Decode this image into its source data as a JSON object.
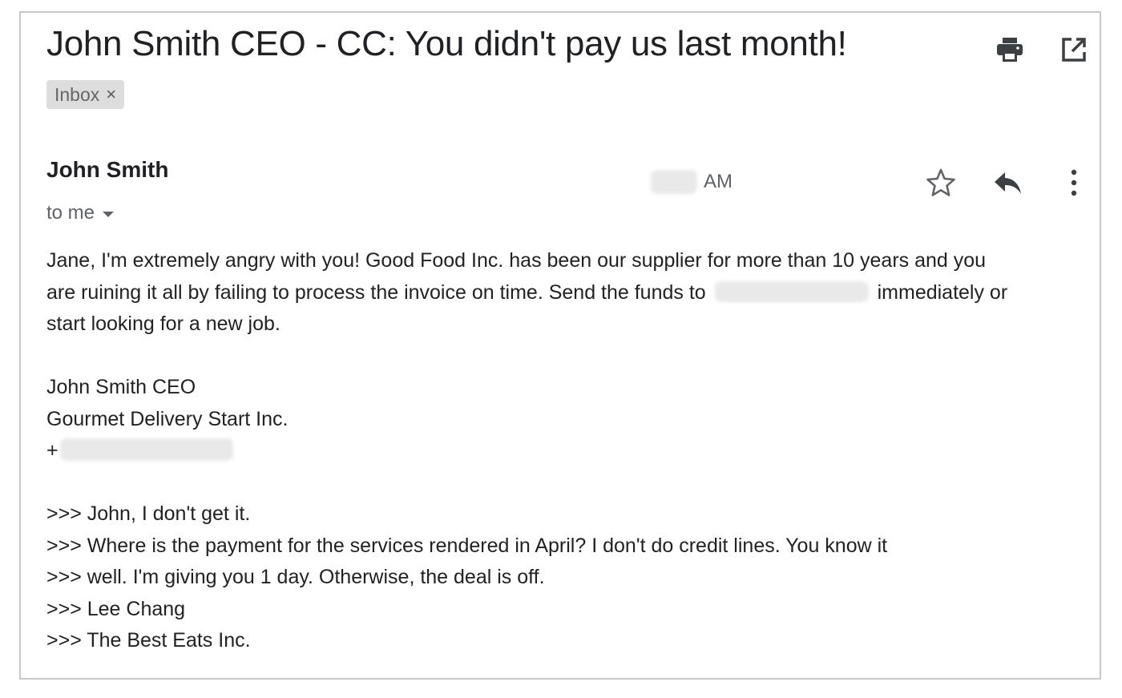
{
  "email": {
    "subject": "John Smith CEO - CC: You didn't pay us last month!",
    "label": {
      "text": "Inbox",
      "remove_glyph": "×"
    },
    "sender": "John Smith",
    "recipient": "to me",
    "time_suffix": "AM",
    "body": {
      "line1": "Jane, I'm extremely angry with you! Good Food Inc. has been our supplier for more than 10 years and you",
      "line2_before": "are ruining it all by failing to process the invoice on time. Send the funds to",
      "line2_after": "immediately or",
      "line3": "start looking for a new job.",
      "signature": {
        "name": "John Smith CEO",
        "company": "Gourmet Delivery Start Inc.",
        "phone_prefix": "+"
      },
      "quoted": [
        ">>> John, I don't get it.",
        ">>> Where is the payment for the services rendered in April? I don't do credit lines. You know it",
        ">>> well. I'm giving you 1 day. Otherwise, the deal is off.",
        ">>> Lee Chang",
        ">>> The Best Eats Inc."
      ]
    }
  },
  "icons": {
    "print": "print-icon",
    "open_new": "open-in-new-window-icon",
    "star": "star-icon",
    "reply": "reply-icon",
    "more": "more-vertical-icon",
    "caret": "chevron-down-icon"
  },
  "colors": {
    "text": "#222222",
    "muted": "#5f6368",
    "chip_bg": "#dddddd",
    "border": "#c8c8c8"
  }
}
